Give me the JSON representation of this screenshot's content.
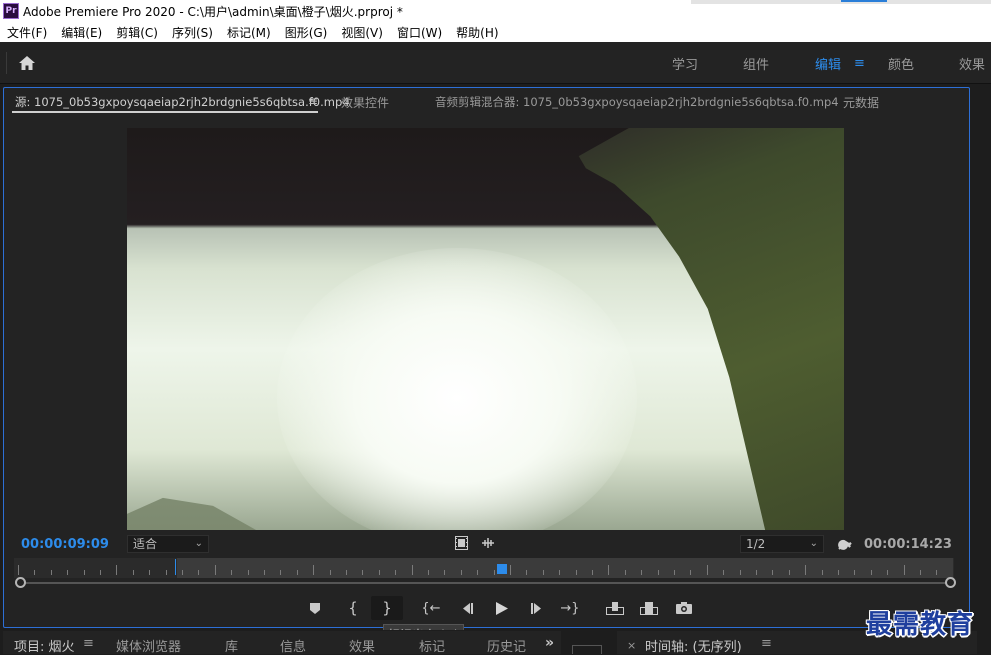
{
  "window": {
    "title": "Adobe Premiere Pro 2020 - C:\\用户\\admin\\桌面\\橙子\\烟火.prproj *",
    "app_icon": "Pr"
  },
  "menu": [
    "文件(F)",
    "编辑(E)",
    "剪辑(C)",
    "序列(S)",
    "标记(M)",
    "图形(G)",
    "视图(V)",
    "窗口(W)",
    "帮助(H)"
  ],
  "workspaces": {
    "tabs": [
      "学习",
      "组件",
      "编辑",
      "颜色",
      "效果"
    ],
    "active": "编辑"
  },
  "source_panel": {
    "tabs": {
      "source": "源: 1075_0b53gxpoysqaeiap2rjh2brdgnie5s6qbtsa.f0.mp4",
      "effect_controls": "效果控件",
      "audio_mixer": "音频剪辑混合器: 1075_0b53gxpoysqaeiap2rjh2brdgnie5s6qbtsa.f0.mp4",
      "metadata": "元数据"
    },
    "timecode_current": "00:00:09:09",
    "timecode_duration": "00:00:14:23",
    "zoom_select": "适合",
    "resolution_select": "1/2",
    "tooltip": "标记出点 (O)"
  },
  "bottom_panels": {
    "left_tabs": [
      "项目: 烟火",
      "媒体浏览器",
      "库",
      "信息",
      "效果",
      "标记",
      "历史记"
    ],
    "timeline_title": "时间轴: (无序列)"
  },
  "watermark": "最需教育",
  "colors": {
    "accent": "#2d8ceb",
    "panel_bg": "#232323",
    "app_bg": "#1d1d1d"
  }
}
